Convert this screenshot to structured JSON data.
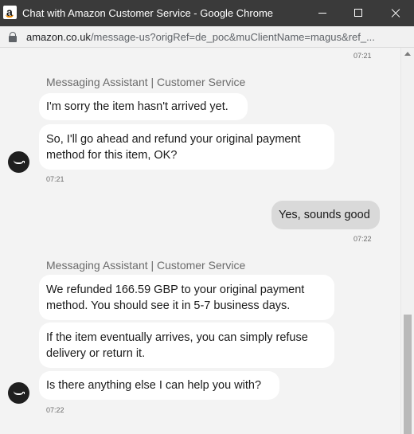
{
  "window": {
    "title": "Chat with Amazon Customer Service - Google Chrome",
    "controls": [
      "minimize-icon",
      "maximize-icon",
      "close-icon"
    ]
  },
  "address": {
    "host": "amazon.co.uk",
    "path": "/message-us?origRef=de_poc&muClientName=magus&ref_..."
  },
  "chat": {
    "top_timestamp": "07:21",
    "groups": [
      {
        "sender": "Messaging Assistant | Customer Service",
        "messages": [
          "I'm sorry the item hasn't arrived yet.",
          "So, I'll go ahead and refund your original payment method for this item, OK?"
        ],
        "timestamp": "07:21"
      },
      {
        "user_message": "Yes, sounds good",
        "timestamp": "07:22"
      },
      {
        "sender": "Messaging Assistant | Customer Service",
        "messages": [
          "We refunded 166.59 GBP to your original payment method. You should see it in 5-7 business days.",
          "If the item eventually arrives, you can simply refuse delivery or return it.",
          "Is there anything else I can help you with?"
        ],
        "timestamp": "07:22"
      }
    ]
  }
}
